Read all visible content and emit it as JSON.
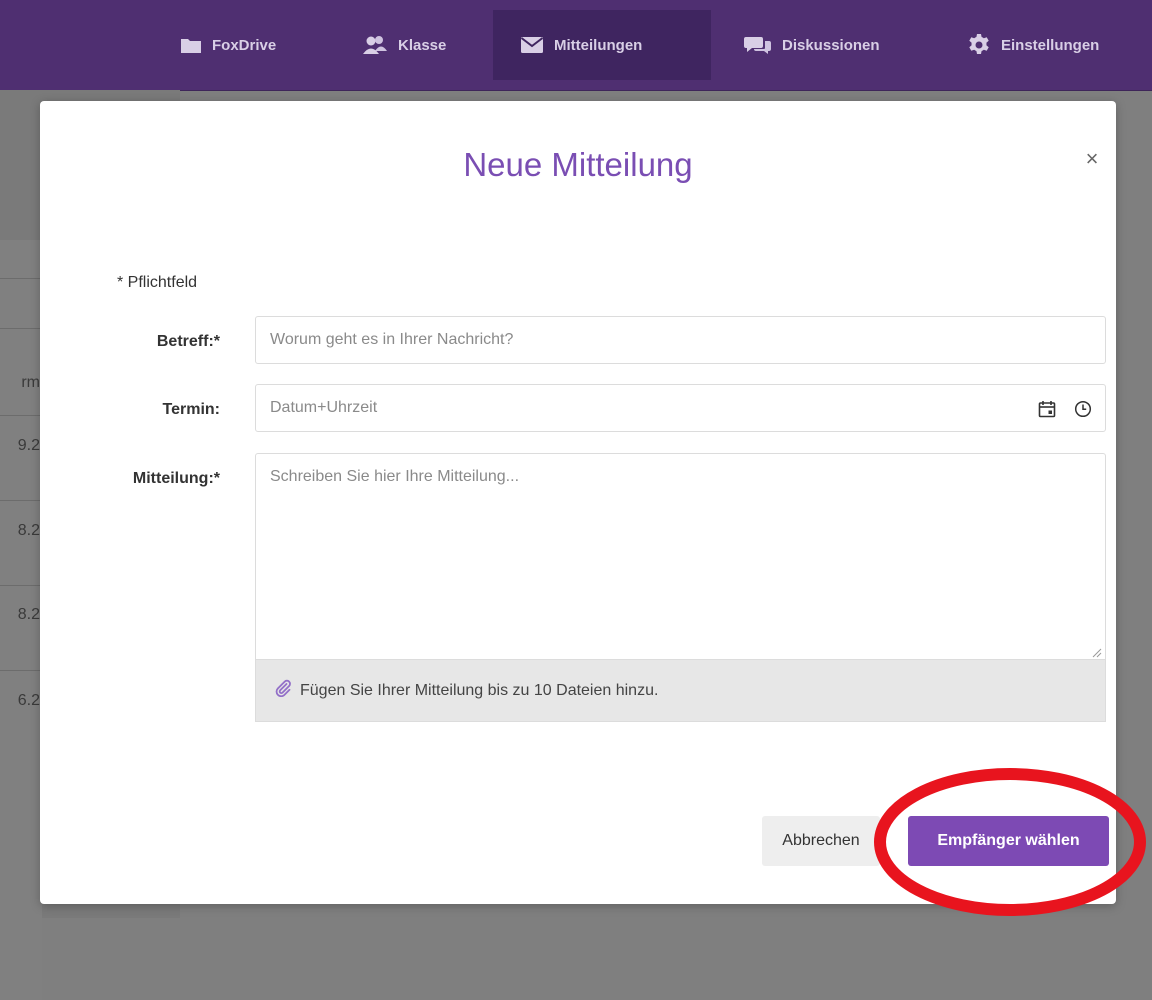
{
  "nav": {
    "items": [
      {
        "label": "FoxDrive",
        "icon": "folder-icon",
        "active": false
      },
      {
        "label": "Klasse",
        "icon": "users-icon",
        "active": false
      },
      {
        "label": "Mitteilungen",
        "icon": "envelope-icon",
        "active": true
      },
      {
        "label": "Diskussionen",
        "icon": "chat-bubbles-icon",
        "active": false
      },
      {
        "label": "Einstellungen",
        "icon": "gear-icon",
        "active": false
      }
    ]
  },
  "background": {
    "fragments": [
      "rm",
      "9.2",
      "8.2",
      "8.2",
      "6.2"
    ]
  },
  "modal": {
    "title": "Neue Mitteilung",
    "close_symbol": "×",
    "required_note": "* Pflichtfeld",
    "fields": {
      "subject": {
        "label": "Betreff:*",
        "placeholder": "Worum geht es in Ihrer Nachricht?"
      },
      "date": {
        "label": "Termin:",
        "placeholder": "Datum+Uhrzeit"
      },
      "message": {
        "label": "Mitteilung:*",
        "placeholder": "Schreiben Sie hier Ihre Mitteilung..."
      }
    },
    "attachment_text": "Fügen Sie Ihrer Mitteilung bis zu 10 Dateien hinzu.",
    "buttons": {
      "cancel": "Abbrechen",
      "primary": "Empfänger wählen"
    }
  },
  "colors": {
    "nav_bg": "#4f2f71",
    "nav_active": "#3f2560",
    "accent": "#7d4ab4",
    "title": "#7a4eb3",
    "highlight": "#e8141e"
  }
}
